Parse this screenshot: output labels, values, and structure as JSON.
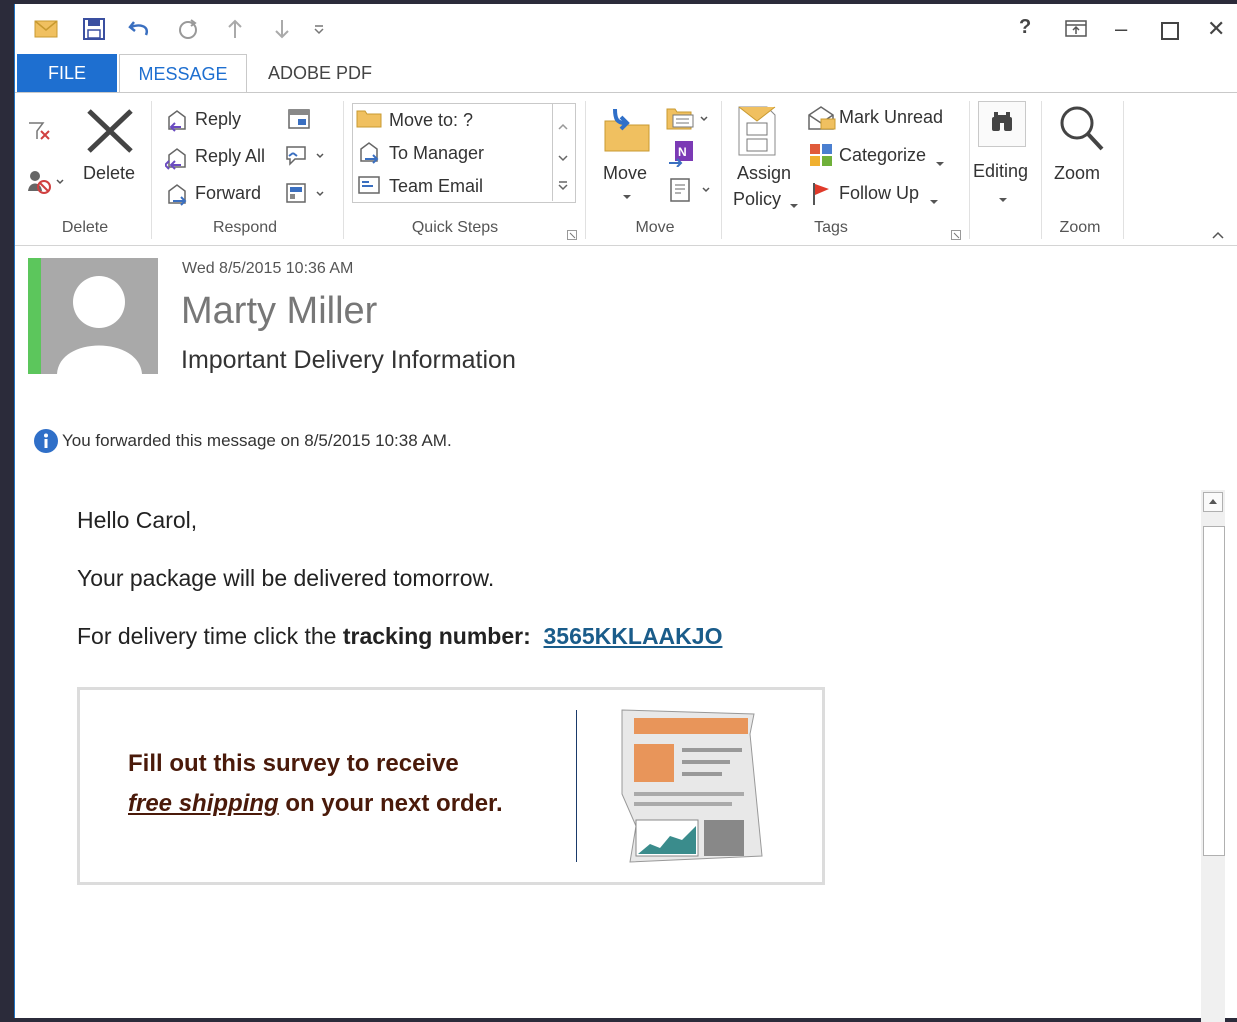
{
  "title_bar": {
    "help_label": "?",
    "minimize_label": "–",
    "close_label": "✕"
  },
  "tabs": [
    {
      "label": "FILE"
    },
    {
      "label": "MESSAGE"
    },
    {
      "label": "ADOBE PDF"
    }
  ],
  "ribbon": {
    "delete_group": {
      "label": "Delete",
      "delete_button": "Delete"
    },
    "respond_group": {
      "label": "Respond",
      "reply": "Reply",
      "reply_all": "Reply All",
      "forward": "Forward"
    },
    "quick_steps_group": {
      "label": "Quick Steps",
      "items": [
        "Move to: ?",
        "To Manager",
        "Team Email"
      ]
    },
    "move_group": {
      "label": "Move",
      "move_button": "Move"
    },
    "tags_group": {
      "label": "Tags",
      "assign_policy_1": "Assign",
      "assign_policy_2": "Policy",
      "mark_unread": "Mark Unread",
      "categorize": "Categorize",
      "follow_up": "Follow Up"
    },
    "editing_group": {
      "editing_button": "Editing"
    },
    "zoom_group": {
      "label": "Zoom",
      "zoom_button": "Zoom"
    }
  },
  "message": {
    "date": "Wed 8/5/2015 10:36 AM",
    "from": "Marty Miller",
    "subject": "Important Delivery Information",
    "info_bar": "You forwarded this message on 8/5/2015 10:38 AM.",
    "greeting": "Hello Carol,",
    "line1": "Your package will be delivered tomorrow.",
    "line2_prefix": "For delivery time click the ",
    "line2_bold": "tracking number:",
    "tracking_number": "3565KKLAAKJO",
    "survey_line1": "Fill out this survey to receive",
    "survey_italic": "free shipping",
    "survey_line2_rest": " on your next order."
  },
  "colors": {
    "accent": "#1e6fd0",
    "presence": "#5cc65c",
    "link": "#1a5c8a",
    "survey_text": "#4a1a0a",
    "orange": "#e8955a"
  }
}
